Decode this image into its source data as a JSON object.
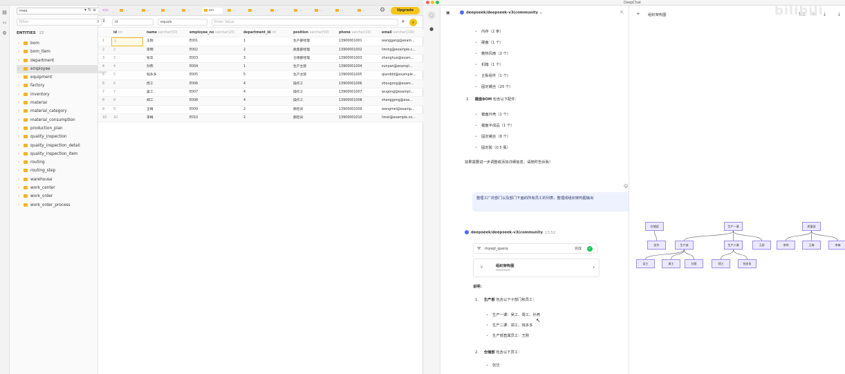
{
  "db": {
    "search_value": "mes",
    "filter_placeholder": "Filter",
    "entities_label": "ENTITIES",
    "entities_count": "22",
    "entities": [
      "bom",
      "bom_item",
      "department",
      "employee",
      "equipment",
      "factory",
      "inventory",
      "material",
      "material_category",
      "material_consumption",
      "production_plan",
      "quality_inspection",
      "quality_inspection_detail",
      "quality_inspection_item",
      "routing",
      "routing_step",
      "warehouse",
      "work_center",
      "work_order",
      "work_order_process"
    ],
    "active_entity": "employee",
    "upgrade_label": "Upgrade",
    "filter_field": "id",
    "filter_op": "equals",
    "filter_value_placeholder": "Enter Value",
    "columns": [
      {
        "name": "id",
        "type": "int"
      },
      {
        "name": "name",
        "type": "varchar(50)"
      },
      {
        "name": "employee_no",
        "type": "varchar(20)"
      },
      {
        "name": "department_id",
        "type": "int"
      },
      {
        "name": "position",
        "type": "varchar(50)"
      },
      {
        "name": "phone",
        "type": "varchar(20)"
      },
      {
        "name": "email",
        "type": "varchar(100)"
      }
    ],
    "rows": [
      [
        "1",
        "王刚",
        "E001",
        "1",
        "生产部经理",
        "13900001001",
        "wanggang@exam..."
      ],
      [
        "2",
        "李明",
        "E002",
        "2",
        "质量部经理",
        "13900001002",
        "liming@example.c..."
      ],
      [
        "3",
        "张华",
        "E003",
        "3",
        "仓储部经理",
        "13900001003",
        "zhanghua@exam..."
      ],
      [
        "4",
        "孙燕",
        "E004",
        "1",
        "生产主管",
        "13900001004",
        "sunyan@exampl..."
      ],
      [
        "5",
        "钱多多",
        "E005",
        "5",
        "生产主管",
        "13900001005",
        "qianddd@example..."
      ],
      [
        "6",
        "周工",
        "E006",
        "4",
        "操作工",
        "13900001006",
        "zhougong@exam..."
      ],
      [
        "7",
        "吴工",
        "E007",
        "4",
        "操作工",
        "13900001007",
        "wugong@exampl..."
      ],
      [
        "8",
        "郑工",
        "E008",
        "4",
        "操作工",
        "13900001008",
        "zhenggong@exa..."
      ],
      [
        "9",
        "王梅",
        "E009",
        "2",
        "质检员",
        "13900001009",
        "wangmei@examp..."
      ],
      [
        "10",
        "李梅",
        "E010",
        "2",
        "质检员",
        "13900001010",
        "limei@example.co..."
      ]
    ]
  },
  "chat": {
    "app_title": "DeepChat",
    "model": "deepseek/deepseek-v3(community",
    "list1": [
      "内存（2 条）",
      "硬盘（1 个）",
      "散热风扇（2 个）",
      "机箱（1 个）",
      "主板组件（1 个）",
      "固定螺丝（20 个）"
    ],
    "item2_num": "2.",
    "item2_bold": "键盘BOM",
    "item2_rest": "包含以下配件：",
    "list2": [
      "键盘外壳（1 个）",
      "键盘半成品（1 个）",
      "固定螺丝（8 个）",
      "固定胶（0.5 瓶）"
    ],
    "question": "如果需要进一步调整或添加详细信息，请随时告诉我！",
    "user_message": "整理工厂的部门以及部门下面的所有员工的列表，整理成组织架构图输出",
    "resp_model": "deepseek/deepseek-v3(community",
    "resp_time": "13:52",
    "tool_name": "mysql_query",
    "tool_status": "完成",
    "artifact_title": "组织架构图",
    "artifact_type": "mermaid",
    "explain_label": "说明：",
    "item1_num": "1.",
    "item1_bold": "生产部",
    "item1_rest": "包含以下子部门和员工：",
    "sub1": [
      "生产一课：吴工、周工、孙燕",
      "生产二课：郑工、钱多多",
      "生产部直属员工：王刚"
    ],
    "item_b_num": "2.",
    "item_b_bold": "仓储部",
    "item_b_rest": "包含以下员工：",
    "sub2": [
      "张华"
    ],
    "mermaid_title": "组织架构图",
    "view_code": "代码",
    "view_preview": "预览",
    "watermark": "bilibili"
  },
  "org_chart": {
    "nodes": [
      "仓储部",
      "张华",
      "生产部",
      "生产一课",
      "生产二课",
      "王刚",
      "吴工",
      "周工",
      "孙燕",
      "郑工",
      "钱多多",
      "质量部",
      "李明",
      "王梅",
      "李梅"
    ]
  }
}
